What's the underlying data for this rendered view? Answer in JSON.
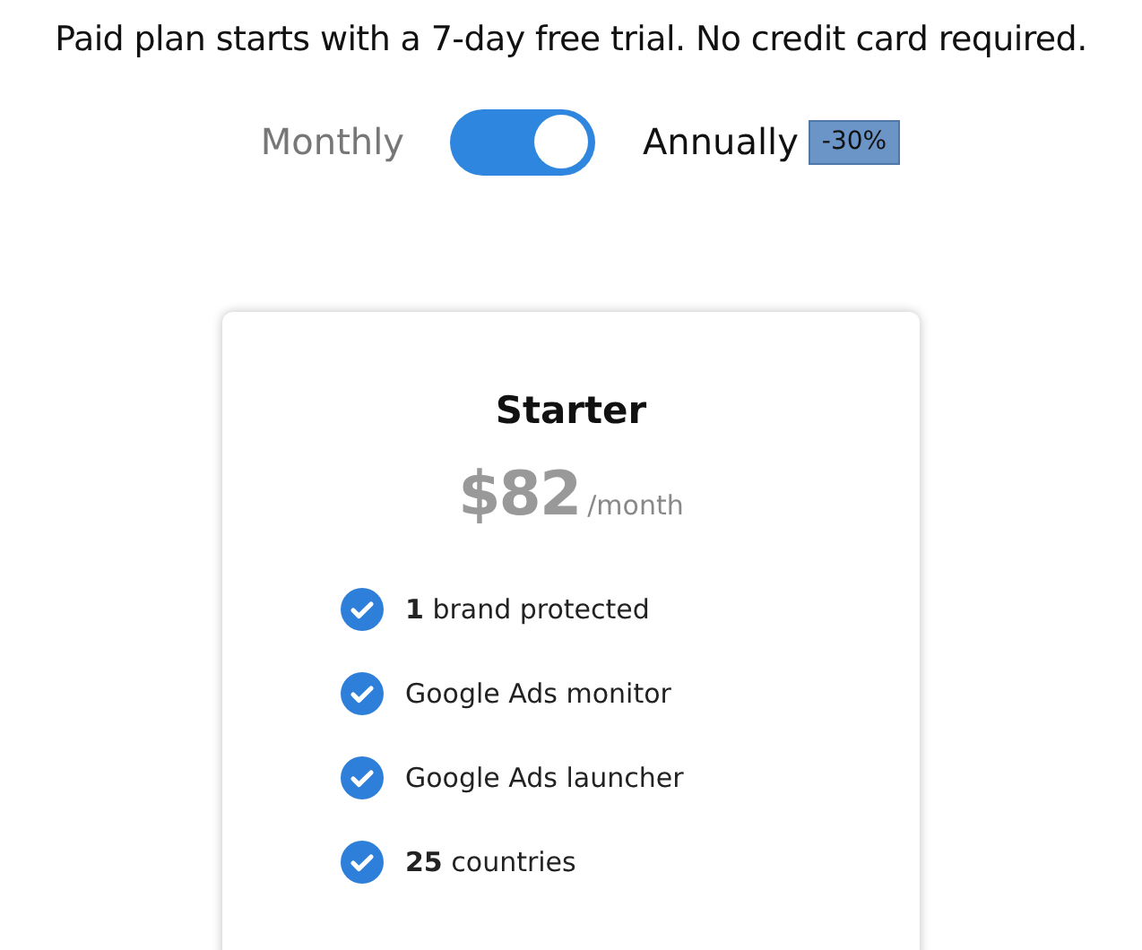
{
  "intro": "Paid plan starts with a 7-day free trial. No credit card required.",
  "billing": {
    "monthly_label": "Monthly",
    "annual_label": "Annually",
    "annual": true,
    "discount": "-30%"
  },
  "plan": {
    "name": "Starter",
    "price": "$82",
    "period": "/month",
    "features": [
      {
        "text": "**1** brand protected",
        "included": true
      },
      {
        "text": "Google Ads monitor",
        "included": true
      },
      {
        "text": "Google Ads launcher",
        "included": true
      },
      {
        "text": "**25** countries",
        "included": true
      }
    ]
  }
}
